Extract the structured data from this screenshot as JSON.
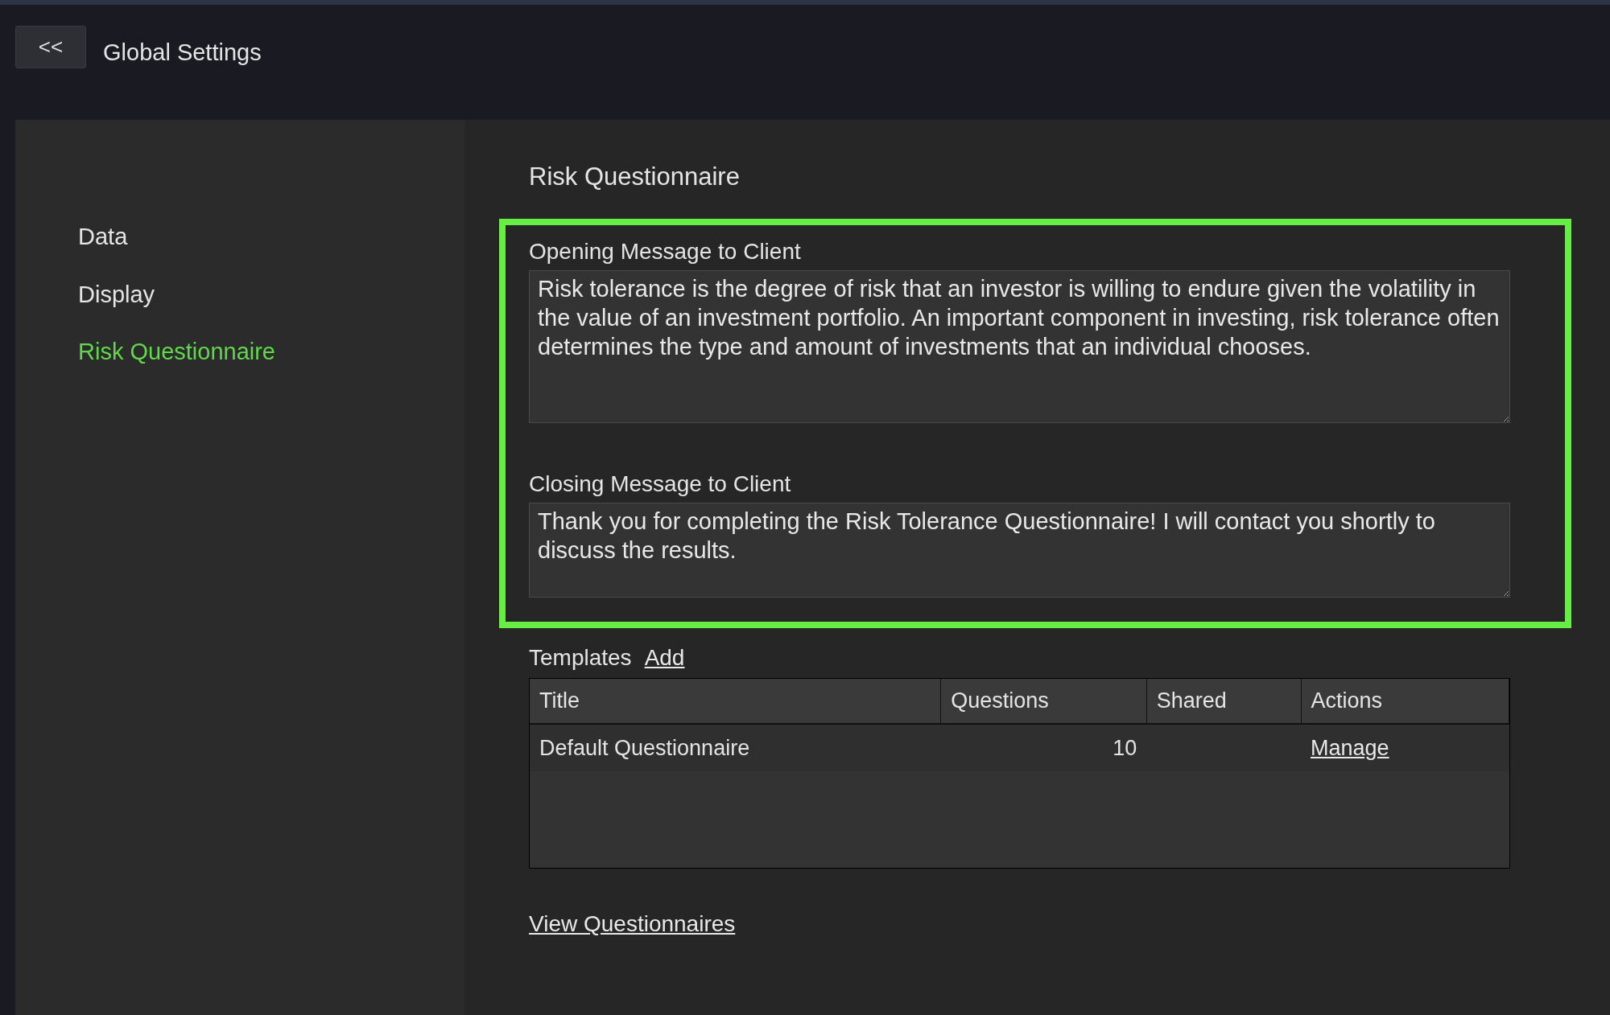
{
  "header": {
    "back_button": "<<",
    "title": "Global Settings"
  },
  "sidebar": {
    "items": [
      {
        "label": "Data",
        "selected": false
      },
      {
        "label": "Display",
        "selected": false
      },
      {
        "label": "Risk Questionnaire",
        "selected": true
      }
    ]
  },
  "main": {
    "heading": "Risk Questionnaire",
    "opening": {
      "label": "Opening Message to Client",
      "value": "Risk tolerance is the degree of risk that an investor is willing to endure given the volatility in the value of an investment portfolio. An important component in investing, risk tolerance often determines the type and amount of investments that an individual chooses."
    },
    "closing": {
      "label": "Closing Message to Client",
      "value": "Thank you for completing the Risk Tolerance Questionnaire! I will contact you shortly to discuss the results."
    },
    "templates": {
      "label": "Templates",
      "add_link": "Add",
      "columns": [
        "Title",
        "Questions",
        "Shared",
        "Actions"
      ],
      "rows": [
        {
          "title": "Default Questionnaire",
          "questions": "10",
          "shared": "",
          "action": "Manage"
        }
      ]
    },
    "view_link": "View Questionnaires"
  }
}
